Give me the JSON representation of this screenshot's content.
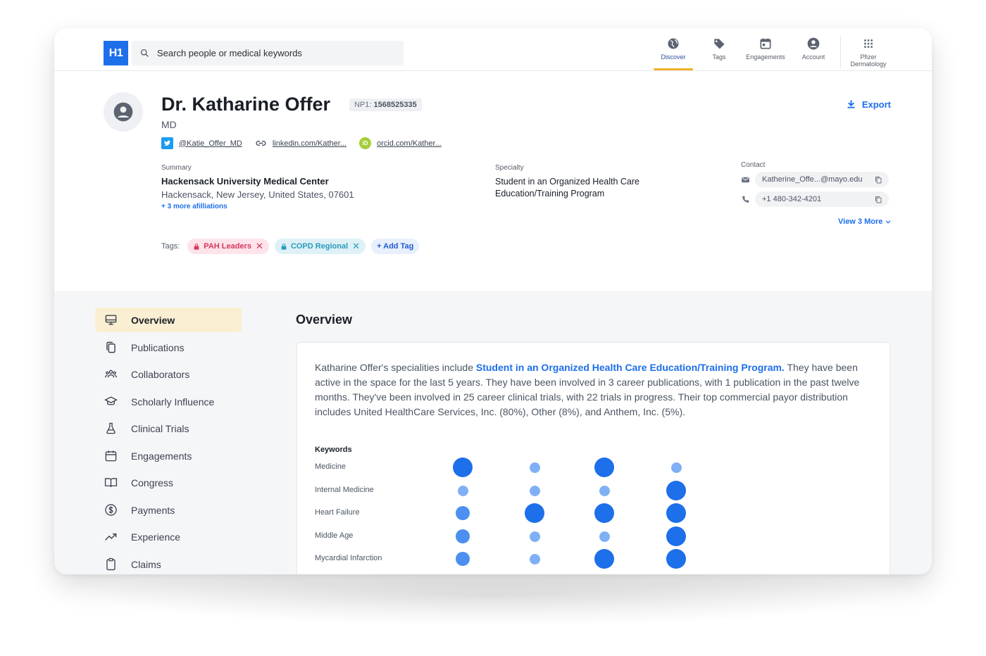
{
  "topbar": {
    "logo": "H1",
    "search_placeholder": "Search people or medical keywords",
    "nav": [
      {
        "label": "Discover",
        "icon": "globe-icon",
        "active": true
      },
      {
        "label": "Tags",
        "icon": "tag-icon"
      },
      {
        "label": "Engagements",
        "icon": "calendar-icon"
      },
      {
        "label": "Account",
        "icon": "account-icon"
      },
      {
        "label": "Pfizer Dermatology",
        "icon": "apps-grid-icon"
      }
    ]
  },
  "profile": {
    "name": "Dr. Katharine Offer",
    "npi_label": "NP1:",
    "npi_value": "1568525335",
    "degree": "MD",
    "links": {
      "twitter": "@Katie_Offer_MD",
      "linkedin": "linkedin.com/Kather...",
      "orcid": "orcid.com/Kather..."
    },
    "export_label": "Export",
    "summary": {
      "label": "Summary",
      "organization": "Hackensack University Medical Center",
      "address": "Hackensack, New Jersey, United States, 07601",
      "more_affiliations": "+ 3 more afilliations"
    },
    "specialty": {
      "label": "Specialty",
      "value": "Student in an Organized Health Care Education/Training Program"
    },
    "contact": {
      "label": "Contact",
      "email": "Katherine_Offe...@mayo.edu",
      "phone": "+1 480-342-4201",
      "view_more": "View 3 More"
    },
    "tags": {
      "label": "Tags:",
      "items": [
        "PAH Leaders",
        "COPD Regional"
      ],
      "add_label": "+ Add Tag"
    }
  },
  "sidebar": {
    "items": [
      {
        "label": "Overview",
        "icon": "monitor-icon",
        "active": true
      },
      {
        "label": "Publications",
        "icon": "documents-icon"
      },
      {
        "label": "Collaborators",
        "icon": "people-icon"
      },
      {
        "label": "Scholarly Influence",
        "icon": "graduation-cap-icon"
      },
      {
        "label": "Clinical Trials",
        "icon": "flask-icon"
      },
      {
        "label": "Engagements",
        "icon": "calendar-icon"
      },
      {
        "label": "Congress",
        "icon": "book-icon"
      },
      {
        "label": "Payments",
        "icon": "dollar-icon"
      },
      {
        "label": "Experience",
        "icon": "trend-icon"
      },
      {
        "label": "Claims",
        "icon": "clipboard-icon"
      }
    ]
  },
  "overview": {
    "title": "Overview",
    "text_before": "Katharine Offer's specialities include ",
    "text_highlight": "Student in an Organized Health Care Education/Training Program.",
    "text_after": " They have been active in the space for the last 5 years. They have been involved in 3 career publications, with 1 publication in the past twelve months. They've been involved in 25 career clinical trials, with 22 trials in progress. Their top commercial payor distribution includes United HealthCare Services, Inc. (80%), Other (8%), and Anthem, Inc. (5%).",
    "keywords_title": "Keywords",
    "keywords": [
      {
        "label": "Medicine",
        "levels": [
          3,
          1,
          3,
          1
        ]
      },
      {
        "label": "Internal Medicine",
        "levels": [
          1,
          1,
          1,
          3
        ]
      },
      {
        "label": "Heart Failure",
        "levels": [
          2,
          3,
          3,
          3
        ]
      },
      {
        "label": "Middle Age",
        "levels": [
          2,
          1,
          1,
          3
        ]
      },
      {
        "label": "Mycardial Infarction",
        "levels": [
          2,
          1,
          3,
          3
        ]
      }
    ]
  },
  "colors": {
    "accent": "#1d6fea",
    "active_nav": "#f2b12b",
    "sidebar_active": "#fbefd3"
  }
}
